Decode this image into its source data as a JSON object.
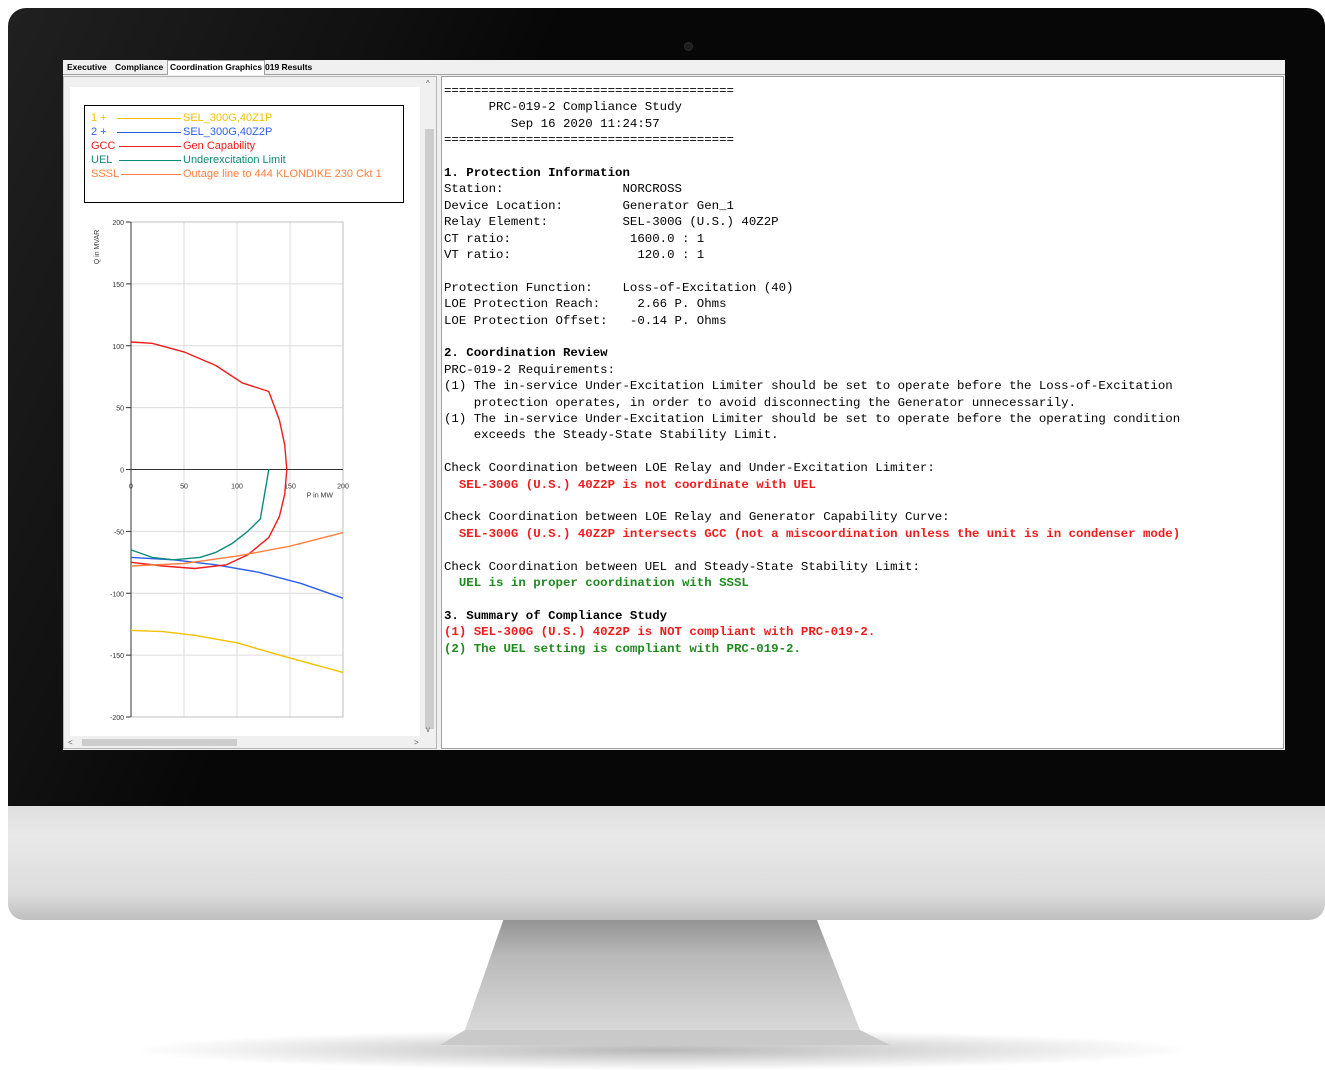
{
  "tabs": [
    {
      "label": "Executive"
    },
    {
      "label": "Compliance"
    },
    {
      "label": "Coordination Graphics"
    },
    {
      "label": "019 Results"
    }
  ],
  "legend": [
    {
      "key": "1 +",
      "name": "SEL_300G,40Z1P",
      "color": "#f5c000"
    },
    {
      "key": "2 +",
      "name": "SEL_300G,40Z2P",
      "color": "#2b5fe8"
    },
    {
      "key": "GCC",
      "name": "Gen Capability",
      "color": "#ee1c1c"
    },
    {
      "key": "UEL",
      "name": "Underexcitation Limit",
      "color": "#0f8a7a"
    },
    {
      "key": "SSSL",
      "name": "Outage line to 444 KLONDIKE 230 Ckt 1",
      "color": "#ff8040"
    }
  ],
  "chart_data": {
    "type": "line",
    "xlabel": "P in MW",
    "ylabel": "Q in MVAR",
    "xlim": [
      0,
      200
    ],
    "ylim": [
      -200,
      200
    ],
    "x_ticks": [
      "0",
      "50",
      "100",
      "150",
      "200"
    ],
    "y_ticks": [
      "200",
      "150",
      "100",
      "50",
      "0",
      "-50",
      "-100",
      "-150",
      "-200"
    ],
    "grid": true,
    "series": [
      {
        "name": "1 +",
        "color": "#f5c000",
        "points": [
          [
            0,
            -130
          ],
          [
            30,
            -131
          ],
          [
            60,
            -134
          ],
          [
            100,
            -140
          ],
          [
            140,
            -150
          ],
          [
            170,
            -157
          ],
          [
            200,
            -164
          ]
        ]
      },
      {
        "name": "2 +",
        "color": "#2b5fe8",
        "points": [
          [
            0,
            -71
          ],
          [
            40,
            -73
          ],
          [
            80,
            -77
          ],
          [
            120,
            -83
          ],
          [
            160,
            -92
          ],
          [
            200,
            -104
          ]
        ]
      },
      {
        "name": "GCC",
        "color": "#ee1c1c",
        "points": [
          [
            0,
            103
          ],
          [
            20,
            102
          ],
          [
            50,
            95
          ],
          [
            80,
            84
          ],
          [
            105,
            70
          ],
          [
            130,
            63
          ],
          [
            140,
            40
          ],
          [
            145,
            20
          ],
          [
            147,
            0
          ],
          [
            145,
            -20
          ],
          [
            140,
            -38
          ],
          [
            130,
            -55
          ],
          [
            110,
            -69
          ],
          [
            90,
            -77
          ],
          [
            60,
            -80
          ],
          [
            30,
            -78
          ],
          [
            0,
            -75
          ]
        ]
      },
      {
        "name": "UEL",
        "color": "#0f8a7a",
        "points": [
          [
            130,
            0
          ],
          [
            127,
            -15
          ],
          [
            122,
            -40
          ],
          [
            110,
            -50
          ],
          [
            95,
            -60
          ],
          [
            80,
            -67
          ],
          [
            65,
            -71
          ],
          [
            40,
            -73
          ],
          [
            20,
            -71
          ],
          [
            0,
            -65
          ]
        ]
      },
      {
        "name": "SSSL",
        "color": "#ff8040",
        "points": [
          [
            0,
            -78
          ],
          [
            50,
            -76
          ],
          [
            100,
            -70
          ],
          [
            150,
            -62
          ],
          [
            200,
            -51
          ]
        ]
      }
    ]
  },
  "report": {
    "lines": [
      {
        "text": "=======================================",
        "style": "plain"
      },
      {
        "text": "      PRC-019-2 Compliance Study",
        "style": "plain"
      },
      {
        "text": "         Sep 16 2020 11:24:57",
        "style": "plain"
      },
      {
        "text": "=======================================",
        "style": "plain"
      },
      {
        "text": "",
        "style": "plain"
      },
      {
        "text": "1. Protection Information",
        "style": "bold"
      },
      {
        "text": "Station:                NORCROSS",
        "style": "plain"
      },
      {
        "text": "Device Location:        Generator Gen_1",
        "style": "plain"
      },
      {
        "text": "Relay Element:          SEL-300G (U.S.) 40Z2P",
        "style": "plain"
      },
      {
        "text": "CT ratio:                1600.0 : 1",
        "style": "plain"
      },
      {
        "text": "VT ratio:                 120.0 : 1",
        "style": "plain"
      },
      {
        "text": "",
        "style": "plain"
      },
      {
        "text": "Protection Function:    Loss-of-Excitation (40)",
        "style": "plain"
      },
      {
        "text": "LOE Protection Reach:     2.66 P. Ohms",
        "style": "plain"
      },
      {
        "text": "LOE Protection Offset:   -0.14 P. Ohms",
        "style": "plain"
      },
      {
        "text": "",
        "style": "plain"
      },
      {
        "text": "2. Coordination Review",
        "style": "bold"
      },
      {
        "text": "PRC-019-2 Requirements:",
        "style": "plain"
      },
      {
        "text": "(1) The in-service Under-Excitation Limiter should be set to operate before the Loss-of-Excitation",
        "style": "plain"
      },
      {
        "text": "    protection operates, in order to avoid disconnecting the Generator unnecessarily.",
        "style": "plain"
      },
      {
        "text": "(1) The in-service Under-Excitation Limiter should be set to operate before the operating condition",
        "style": "plain"
      },
      {
        "text": "    exceeds the Steady-State Stability Limit.",
        "style": "plain"
      },
      {
        "text": "",
        "style": "plain"
      },
      {
        "text": "Check Coordination between LOE Relay and Under-Excitation Limiter:",
        "style": "plain"
      },
      {
        "text": "  SEL-300G (U.S.) 40Z2P is not coordinate with UEL",
        "style": "red"
      },
      {
        "text": "",
        "style": "plain"
      },
      {
        "text": "Check Coordination between LOE Relay and Generator Capability Curve:",
        "style": "plain"
      },
      {
        "text": "  SEL-300G (U.S.) 40Z2P intersects GCC (not a miscoordination unless the unit is in condenser mode)",
        "style": "red"
      },
      {
        "text": "",
        "style": "plain"
      },
      {
        "text": "Check Coordination between UEL and Steady-State Stability Limit:",
        "style": "plain"
      },
      {
        "text": "  UEL is in proper coordination with SSSL",
        "style": "green"
      },
      {
        "text": "",
        "style": "plain"
      },
      {
        "text": "3. Summary of Compliance Study",
        "style": "bold"
      },
      {
        "text": "(1) SEL-300G (U.S.) 40Z2P is NOT compliant with PRC-019-2.",
        "style": "red"
      },
      {
        "text": "(2) The UEL setting is compliant with PRC-019-2.",
        "style": "green"
      }
    ]
  }
}
